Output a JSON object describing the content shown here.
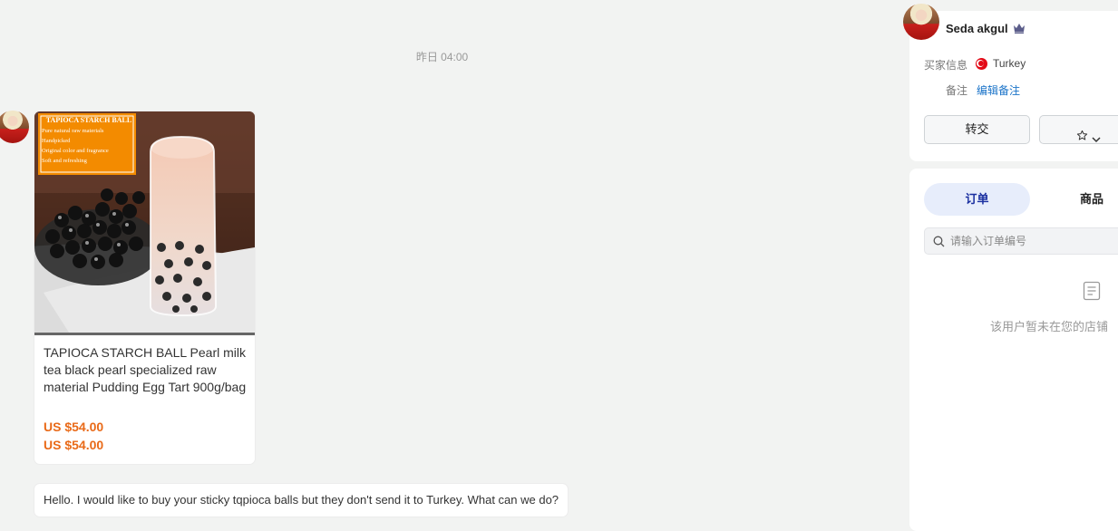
{
  "chat": {
    "timestamp": "昨日 04:00",
    "product": {
      "image_banner": {
        "title": "TAPIOCA STARCH BALL",
        "lines": [
          "Pure natural raw materials",
          "Handpicked",
          "Original color and fragrance",
          "Soft and refreshing"
        ]
      },
      "title": "TAPIOCA STARCH BALL Pearl milk tea black pearl specialized raw material Pudding Egg Tart 900g/bag",
      "price_1": "US $54.00",
      "price_2": "US $54.00",
      "price_color": "#e96a18"
    },
    "message": "Hello. I would like to buy your sticky tqpioca balls but they don't send it to Turkey. What can we do?"
  },
  "panel": {
    "user": {
      "name": "Seda akgul",
      "badge_icon": "crown-icon",
      "buyer_info_label": "买家信息",
      "country_flag": "turkey-flag-icon",
      "country": "Turkey",
      "note_label": "备注",
      "edit_note": "编辑备注",
      "link_color": "#1a73c8"
    },
    "actions": {
      "transfer": "转交",
      "favorite_icon": "star-icon",
      "dropdown_icon": "chevron-down-icon"
    },
    "tabs": [
      {
        "label": "订单",
        "active": true
      },
      {
        "label": "商品",
        "active": false
      }
    ],
    "search": {
      "placeholder": "请输入订单编号",
      "value": ""
    },
    "empty_state": {
      "icon": "document-icon",
      "text": "该用户暂未在您的店铺"
    }
  }
}
